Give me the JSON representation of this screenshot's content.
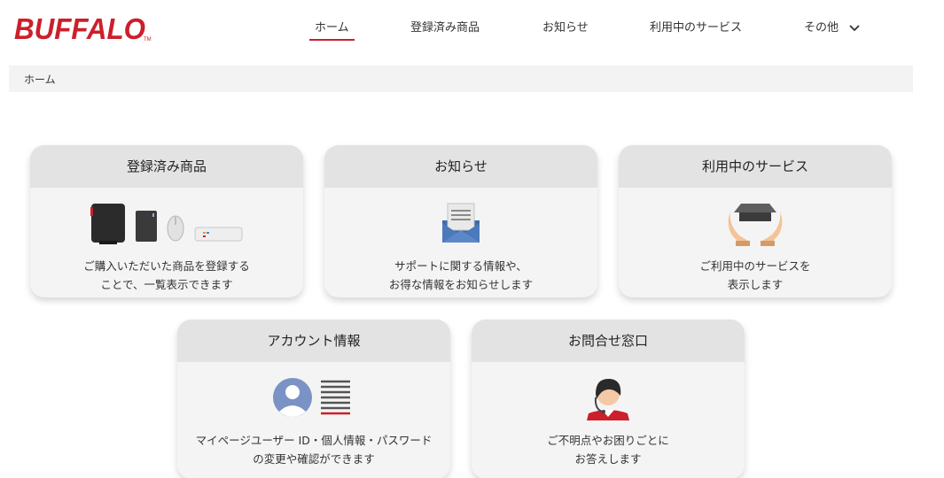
{
  "brand": {
    "logo_text": "BUFFALO",
    "tm": "TM",
    "brand_color": "#cc1f2b"
  },
  "nav": {
    "items": [
      {
        "label": "ホーム",
        "active": true
      },
      {
        "label": "登録済み商品",
        "active": false
      },
      {
        "label": "お知らせ",
        "active": false
      },
      {
        "label": "利用中のサービス",
        "active": false
      },
      {
        "label": "その他",
        "active": false,
        "icon": "chevron-down-icon"
      }
    ]
  },
  "breadcrumb": {
    "current": "ホーム"
  },
  "cards": {
    "registered": {
      "title": "登録済み商品",
      "line1": "ご購入いただいた商品を登録する",
      "line2": "ことで、一覧表示できます",
      "icon": "products-icon"
    },
    "news": {
      "title": "お知らせ",
      "line1": "サポートに関する情報や、",
      "line2": "お得な情報をお知らせします",
      "icon": "envelope-icon"
    },
    "services": {
      "title": "利用中のサービス",
      "line1": "ご利用中のサービスを",
      "line2": "表示します",
      "icon": "hands-box-icon"
    },
    "account": {
      "title": "アカウント情報",
      "line1": "マイページユーザー ID・個人情報・パスワード",
      "line2": "の変更や確認ができます",
      "icon": "user-profile-icon"
    },
    "contact": {
      "title": "お問合せ窓口",
      "line1": "ご不明点やお困りごとに",
      "line2": "お答えします",
      "icon": "operator-icon"
    }
  }
}
